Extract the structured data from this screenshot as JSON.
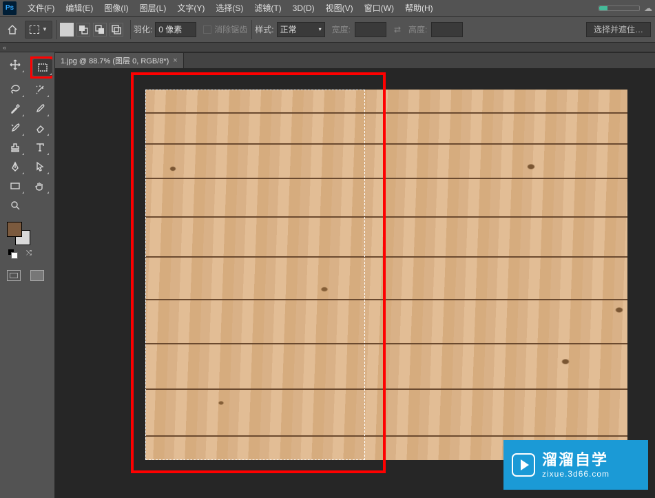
{
  "menubar": {
    "logo": "Ps",
    "items": [
      "文件(F)",
      "编辑(E)",
      "图像(I)",
      "图层(L)",
      "文字(Y)",
      "选择(S)",
      "滤镜(T)",
      "3D(D)",
      "视图(V)",
      "窗口(W)",
      "帮助(H)"
    ]
  },
  "optionsbar": {
    "feather_label": "羽化:",
    "feather_value": "0 像素",
    "antialias_label": "消除锯齿",
    "style_label": "样式:",
    "style_value": "正常",
    "width_label": "宽度:",
    "height_label": "高度:",
    "mask_button": "选择并遮住…"
  },
  "tabs": {
    "small_tab": "«",
    "doc_title": "1.jpg @ 88.7% (图层 0, RGB/8*)"
  },
  "tools": {
    "list": [
      {
        "name": "move-tool"
      },
      {
        "name": "marquee-tool"
      },
      {
        "name": "lasso-tool"
      },
      {
        "name": "magic-wand-tool"
      },
      {
        "name": "eyedropper-tool"
      },
      {
        "name": "brush-tool"
      },
      {
        "name": "history-brush-tool"
      },
      {
        "name": "eraser-tool"
      },
      {
        "name": "clone-stamp-tool"
      },
      {
        "name": "type-tool"
      },
      {
        "name": "pen-tool"
      },
      {
        "name": "path-select-tool"
      },
      {
        "name": "rectangle-tool"
      },
      {
        "name": "hand-tool"
      },
      {
        "name": "zoom-tool"
      },
      {
        "name": "empty"
      }
    ],
    "fg_color": "#7b5a3e",
    "bg_color": "#d9d9d9"
  },
  "watermark": {
    "title": "溜溜自学",
    "url": "zixue.3d66.com"
  }
}
